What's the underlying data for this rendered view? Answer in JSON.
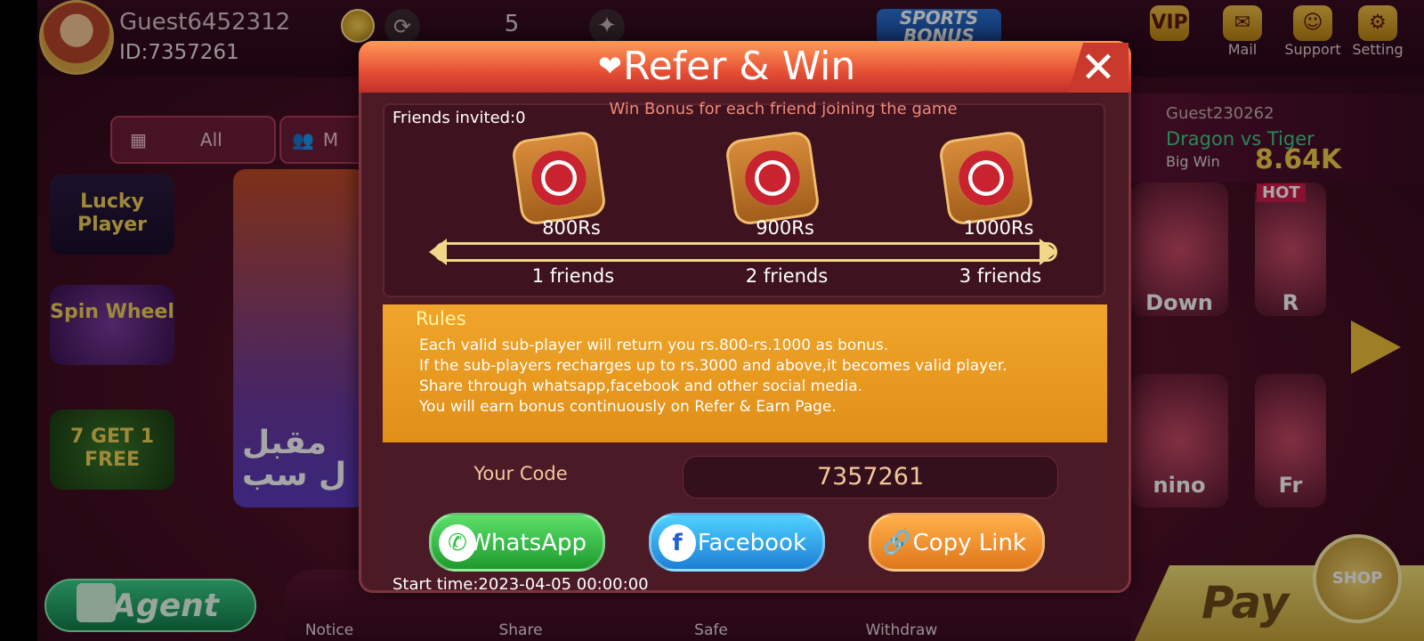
{
  "colors": {
    "accent": "#e64f35",
    "rules_bg": "#f0a52a",
    "whatsapp": "#2fbf3e",
    "facebook": "#1d8ee6",
    "copy": "#f08a1c"
  },
  "user": {
    "name": "Guest6452312",
    "id": "ID:7357261",
    "balance": "5"
  },
  "top_icons": {
    "vip": "VIP",
    "mail": "Mail",
    "support": "Support",
    "setting": "Setting",
    "sports": "SPORTS BONUS"
  },
  "tabs": [
    {
      "label": "All"
    },
    {
      "label": "M"
    }
  ],
  "side": {
    "lucky": "Lucky Player",
    "spin": "Spin Wheel",
    "seven": "7 GET 1 FREE",
    "banner_text": "مقبل\nل سب"
  },
  "right_panel": {
    "player": "Guest230262",
    "game": "Dragon vs Tiger",
    "bigwin_label": "Big Win",
    "bigwin_value": "8.64K"
  },
  "cards": {
    "hot": "HOT",
    "down": "Down",
    "r": "R",
    "domino": "nino",
    "fr": "Fr"
  },
  "bottom": {
    "agent": "Agent",
    "notice": "Notice",
    "share": "Share",
    "safe": "Safe",
    "withdraw": "Withdraw",
    "pay": "Pay",
    "shop": "SHOP"
  },
  "dialog": {
    "title": "Refer & Win",
    "close": "✕",
    "friends_invited": "Friends invited:0",
    "win_bonus": "Win Bonus for each friend joining the game",
    "tiers": [
      {
        "amount": "800Rs",
        "friends": "1 friends"
      },
      {
        "amount": "900Rs",
        "friends": "2 friends"
      },
      {
        "amount": "1000Rs",
        "friends": "3 friends"
      }
    ],
    "rules_title": "Rules",
    "rules": [
      "Each valid sub-player will return you rs.800-rs.1000 as bonus.",
      "If the sub-players recharges up to rs.3000 and above,it becomes valid player.",
      "Share through whatsapp,facebook and other social media.",
      "You will earn bonus continuously on Refer & Earn Page."
    ],
    "code_label": "Your Code",
    "code_value": "7357261",
    "buttons": {
      "whatsapp": "WhatsApp",
      "facebook": "Facebook",
      "copy": "Copy Link"
    },
    "start_time": "Start time:2023-04-05 00:00:00"
  }
}
